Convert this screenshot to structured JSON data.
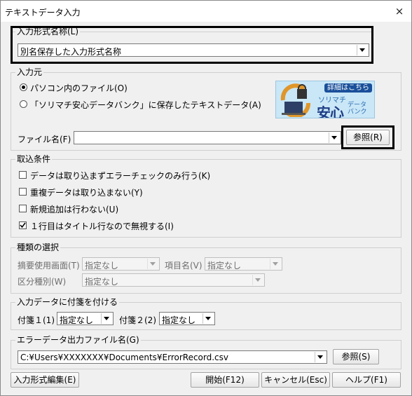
{
  "window": {
    "title": "テキストデータ入力",
    "close_icon": "×"
  },
  "format_name": {
    "label": "入力形式名称(L)",
    "value": "別名保存した入力形式名称"
  },
  "input_source": {
    "label": "入力元",
    "radio_pc": "パソコン内のファイル(O)",
    "radio_bank": "「ソリマチ安心データバンク」に保存したテキストデータ(A)",
    "file_label": "ファイル名(F)",
    "file_value": "",
    "browse_label": "参照(R)",
    "badge": {
      "top": "詳細はこちら",
      "brand1": "ソリマチ",
      "brand2": "安心",
      "brand3a": "データ",
      "brand3b": "バンク"
    }
  },
  "import_conditions": {
    "label": "取込条件",
    "options": [
      {
        "label": "データは取り込まずエラーチェックのみ行う(K)",
        "checked": false
      },
      {
        "label": "重複データは取り込まない(Y)",
        "checked": false
      },
      {
        "label": "新規追加は行わない(U)",
        "checked": false
      },
      {
        "label": "１行目はタイトル行なので無視する(I)",
        "checked": true
      }
    ]
  },
  "type_selection": {
    "label": "種類の選択",
    "summary_screen_label": "摘要使用画面(T)",
    "summary_screen_value": "指定なし",
    "item_name_label": "項目名(V)",
    "item_name_value": "指定なし",
    "category_label": "区分種別(W)",
    "category_value": "指定なし"
  },
  "tags": {
    "label": "入力データに付箋を付ける",
    "tag1_label": "付箋１(1)",
    "tag1_value": "指定なし",
    "tag2_label": "付箋２(2)",
    "tag2_value": "指定なし"
  },
  "error_output": {
    "label": "エラーデータ出力ファイル名(G)",
    "value": "C:¥Users¥XXXXXXX¥Documents¥ErrorRecord.csv",
    "browse_label": "参照(S)"
  },
  "footer": {
    "edit_format": "入力形式編集(E)",
    "start": "開始(F12)",
    "cancel": "キャンセル(Esc)",
    "help": "ヘルプ(F1)"
  }
}
